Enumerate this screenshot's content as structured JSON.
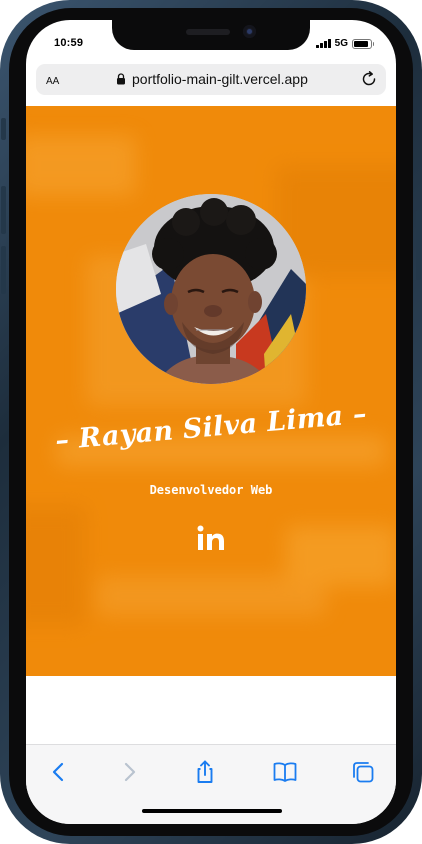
{
  "status_bar": {
    "time": "10:59",
    "network": "5G",
    "battery_level": 0.9
  },
  "browser": {
    "text_size_label": "AA",
    "url": "portfolio-main-gilt.vercel.app",
    "icons": {
      "lock": "lock-icon",
      "reload": "reload-icon"
    }
  },
  "page": {
    "name": "– Rayan Silva Lima –",
    "role": "Desenvolvedor Web",
    "social_icon": "linkedin-icon",
    "accent_color": "#f08a0a"
  },
  "toolbar": {
    "items": [
      {
        "icon": "back-icon",
        "enabled": true
      },
      {
        "icon": "forward-icon",
        "enabled": false
      },
      {
        "icon": "share-icon",
        "enabled": true
      },
      {
        "icon": "bookmarks-icon",
        "enabled": true
      },
      {
        "icon": "tabs-icon",
        "enabled": true
      }
    ],
    "tint_color": "#1a7cf0"
  }
}
